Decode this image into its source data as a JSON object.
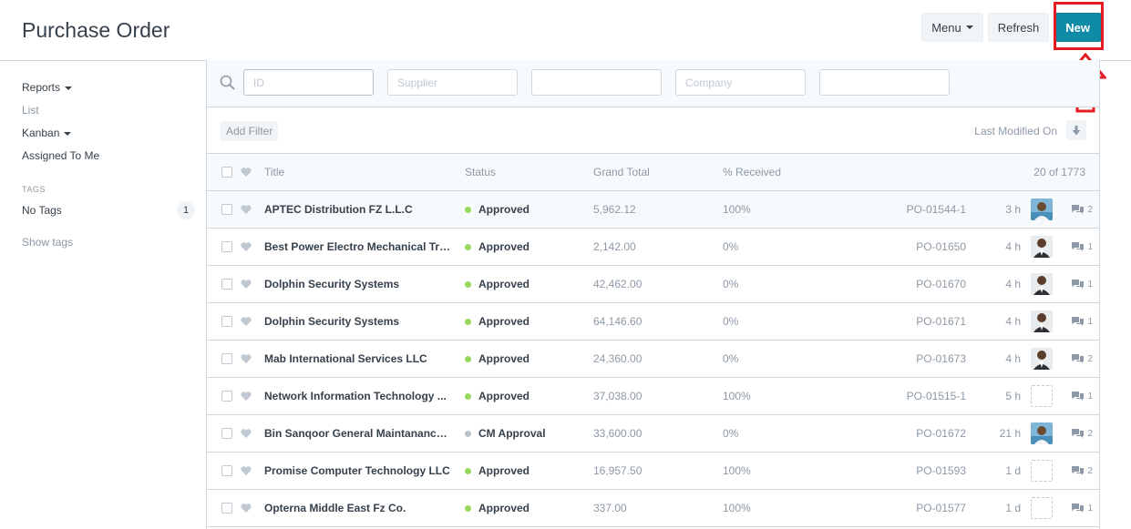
{
  "page": {
    "title": "Purchase Order"
  },
  "header": {
    "menu_label": "Menu",
    "refresh_label": "Refresh",
    "new_label": "New"
  },
  "sidebar": {
    "items": [
      {
        "label": "Reports",
        "dropdown": true
      },
      {
        "label": "List",
        "dropdown": false
      },
      {
        "label": "Kanban",
        "dropdown": true
      },
      {
        "label": "Assigned To Me",
        "dropdown": false
      }
    ],
    "tags_heading": "TAGS",
    "no_tags_label": "No Tags",
    "no_tags_count": "1",
    "show_tags": "Show tags"
  },
  "filters": {
    "id_placeholder": "ID",
    "supplier_placeholder": "Supplier",
    "field3_placeholder": "",
    "company_placeholder": "Company",
    "field5_placeholder": "",
    "add_filter": "Add Filter",
    "sort_label": "Last Modified On"
  },
  "list": {
    "headers": {
      "title": "Title",
      "status": "Status",
      "grand_total": "Grand Total",
      "received": "% Received",
      "count": "20 of 1773"
    },
    "rows": [
      {
        "title": "APTEC Distribution FZ L.L.C",
        "status": "Approved",
        "status_color": "#98d85b",
        "total": "5,962.12",
        "received": "100%",
        "id": "PO-01544-1",
        "time": "3 h",
        "avatar": "photo-a",
        "comments": "2"
      },
      {
        "title": "Best Power Electro Mechanical Tra...",
        "status": "Approved",
        "status_color": "#98d85b",
        "total": "2,142.00",
        "received": "0%",
        "id": "PO-01650",
        "time": "4 h",
        "avatar": "photo-b",
        "comments": "1"
      },
      {
        "title": "Dolphin Security Systems",
        "status": "Approved",
        "status_color": "#98d85b",
        "total": "42,462.00",
        "received": "0%",
        "id": "PO-01670",
        "time": "4 h",
        "avatar": "photo-b",
        "comments": "1"
      },
      {
        "title": "Dolphin Security Systems",
        "status": "Approved",
        "status_color": "#98d85b",
        "total": "64,146.60",
        "received": "0%",
        "id": "PO-01671",
        "time": "4 h",
        "avatar": "photo-b",
        "comments": "1"
      },
      {
        "title": "Mab International Services LLC",
        "status": "Approved",
        "status_color": "#98d85b",
        "total": "24,360.00",
        "received": "0%",
        "id": "PO-01673",
        "time": "4 h",
        "avatar": "photo-b",
        "comments": "2"
      },
      {
        "title": "Network Information Technology ...",
        "status": "Approved",
        "status_color": "#98d85b",
        "total": "37,038.00",
        "received": "100%",
        "id": "PO-01515-1",
        "time": "5 h",
        "avatar": "empty",
        "comments": "1"
      },
      {
        "title": "Bin Sanqoor General Maintanance...",
        "status": "CM Approval",
        "status_color": "#b8c2cc",
        "total": "33,600.00",
        "received": "0%",
        "id": "PO-01672",
        "time": "21 h",
        "avatar": "photo-a",
        "comments": "2"
      },
      {
        "title": "Promise Computer Technology LLC",
        "status": "Approved",
        "status_color": "#98d85b",
        "total": "16,957.50",
        "received": "100%",
        "id": "PO-01593",
        "time": "1 d",
        "avatar": "empty",
        "comments": "2"
      },
      {
        "title": "Opterna Middle East Fz Co.",
        "status": "Approved",
        "status_color": "#98d85b",
        "total": "337.00",
        "received": "100%",
        "id": "PO-01577",
        "time": "1 d",
        "avatar": "empty",
        "comments": "1"
      }
    ]
  },
  "colors": {
    "primary": "#0f8ba5",
    "highlight": "#e51c23",
    "approved": "#98d85b",
    "pending": "#b8c2cc"
  }
}
